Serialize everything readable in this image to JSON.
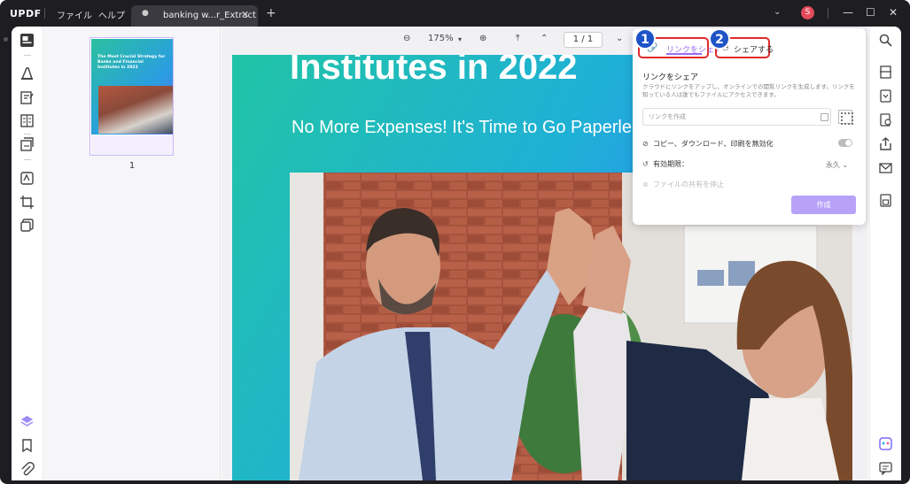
{
  "titlebar": {
    "logo": "UPDF",
    "menu_file": "ファイル",
    "menu_help": "ヘルプ",
    "tab_name": "banking w...r_Extract",
    "avatar_letter": "S"
  },
  "thumbnails": {
    "thumb_title": "The Most Crucial Strategy for Banks and Financial Institutes in 2022",
    "page_number": "1"
  },
  "toolbar": {
    "zoom": "175%",
    "page_indicator": "1 / 1"
  },
  "document": {
    "heading": "Institutes in 2022",
    "subheading": "No More Expenses! It's Time to Go Paperle"
  },
  "share_panel": {
    "tab_link_label": "リンクをシェア",
    "tab_share_label": "シェアする",
    "badge_1": "1",
    "badge_2": "2",
    "section_title": "リンクをシェア",
    "description": "クラウドにリンクをアップし、オンラインでの閲覧リンクを生成します。リンクを知っている人は誰でもファイルにアクセスできます。",
    "link_placeholder": "リンクを作成",
    "disable_label": "コピー、ダウンロード、印刷を無効化",
    "expiry_label": "有効期限：",
    "expiry_value": "永久",
    "stop_sharing_label": "ファイルの共有を停止",
    "create_button": "作成"
  },
  "colors": {
    "accent": "#9c6cf0",
    "highlight": "#e02a2a",
    "badge": "#1f54c8",
    "create_button": "#b7a2f8"
  }
}
